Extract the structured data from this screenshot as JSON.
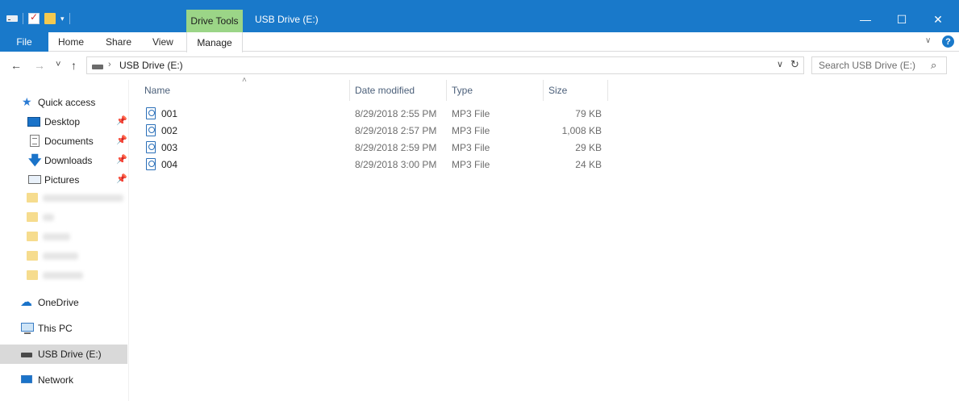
{
  "window": {
    "title": "USB Drive (E:)",
    "context_tab_group": "Drive Tools",
    "controls": {
      "minimize": "—",
      "maximize": "☐",
      "close": "✕"
    }
  },
  "quick_access_toolbar": {
    "items": [
      "drive-icon",
      "properties-icon",
      "new-folder-icon",
      "customize-dropdown"
    ],
    "dropdown_glyph": "▾"
  },
  "ribbon": {
    "tabs": [
      {
        "label": "File"
      },
      {
        "label": "Home"
      },
      {
        "label": "Share"
      },
      {
        "label": "View"
      },
      {
        "label": "Manage"
      }
    ],
    "collapse_glyph": "∨",
    "help_glyph": "?"
  },
  "navigation": {
    "back": "←",
    "forward": "→",
    "recent": "˅",
    "up": "↑",
    "address_separator": "›",
    "address_path": "USB Drive (E:)",
    "address_dropdown": "∨",
    "refresh": "↻",
    "search_placeholder": "Search USB Drive (E:)",
    "search_glyph": "⌕"
  },
  "sidebar": {
    "quick_access": {
      "label": "Quick access",
      "icon": "star-icon"
    },
    "pinned": [
      {
        "label": "Desktop",
        "icon": "desktop-icon",
        "pin": "📌"
      },
      {
        "label": "Documents",
        "icon": "documents-icon",
        "pin": "📌"
      },
      {
        "label": "Downloads",
        "icon": "downloads-icon",
        "pin": "📌"
      },
      {
        "label": "Pictures",
        "icon": "pictures-icon",
        "pin": "📌"
      }
    ],
    "locations": [
      {
        "label": "OneDrive",
        "icon": "onedrive-icon"
      },
      {
        "label": "This PC",
        "icon": "this-pc-icon"
      },
      {
        "label": "USB Drive (E:)",
        "icon": "usb-drive-icon",
        "selected": true
      },
      {
        "label": "Network",
        "icon": "network-icon"
      }
    ]
  },
  "file_list": {
    "columns": [
      "Name",
      "Date modified",
      "Type",
      "Size"
    ],
    "sort_indicator": "˄",
    "rows": [
      {
        "name": "001",
        "date_modified": "8/29/2018 2:55 PM",
        "type": "MP3 File",
        "size": "79 KB"
      },
      {
        "name": "002",
        "date_modified": "8/29/2018 2:57 PM",
        "type": "MP3 File",
        "size": "1,008 KB"
      },
      {
        "name": "003",
        "date_modified": "8/29/2018 2:59 PM",
        "type": "MP3 File",
        "size": "29 KB"
      },
      {
        "name": "004",
        "date_modified": "8/29/2018 3:00 PM",
        "type": "MP3 File",
        "size": "24 KB"
      }
    ]
  },
  "colors": {
    "titlebar": "#1979ca",
    "drive_tools_tab": "#9bd587",
    "selected_nav": "#d9d9d9",
    "column_header_text": "#4c607a"
  }
}
